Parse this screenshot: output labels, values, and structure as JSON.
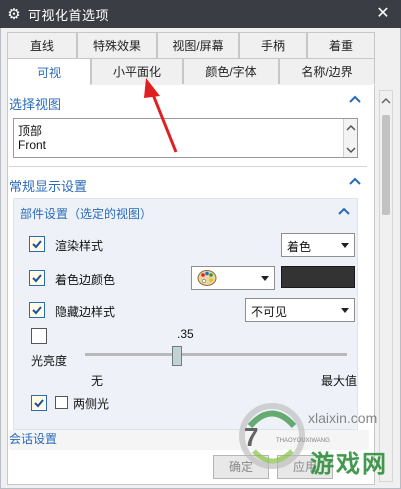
{
  "window": {
    "title": "可视化首选项",
    "close_glyph": "✕",
    "gear_glyph": "⚙"
  },
  "tabs_row1": [
    "直线",
    "特殊效果",
    "视图/屏幕",
    "手柄",
    "着重"
  ],
  "tabs_row2": [
    "可视",
    "小平面化",
    "颜色/字体",
    "名称/边界"
  ],
  "active_tab": "可视",
  "select_view": {
    "header": "选择视图",
    "items": [
      "顶部",
      "Front"
    ]
  },
  "general_display": {
    "header": "常规显示设置",
    "part_settings": {
      "header": "部件设置（选定的视图）",
      "render_style": {
        "label": "渲染样式",
        "value": "着色"
      },
      "shaded_edge_color": {
        "label": "着色边颜色"
      },
      "hidden_edge_style": {
        "label": "隐藏边样式",
        "value": "不可见"
      },
      "light_brightness": {
        "label": "光亮度",
        "value_text": ".35",
        "min_label": "无",
        "max_label": "最大值",
        "fraction": 0.35
      },
      "two_sided_light": {
        "label": "两侧光"
      }
    }
  },
  "session_settings": {
    "header": "会话设置"
  },
  "footer": {
    "ok": "确定",
    "apply": "应用"
  },
  "watermark": {
    "site": "xlaixin.com",
    "cn": "游戏网",
    "sub": "THAOYOUXIWANG"
  },
  "colors": {
    "accent": "#2a6ab9",
    "titlebar": "#3a3d44",
    "swatch": "#333333",
    "arrow": "#e02020"
  }
}
